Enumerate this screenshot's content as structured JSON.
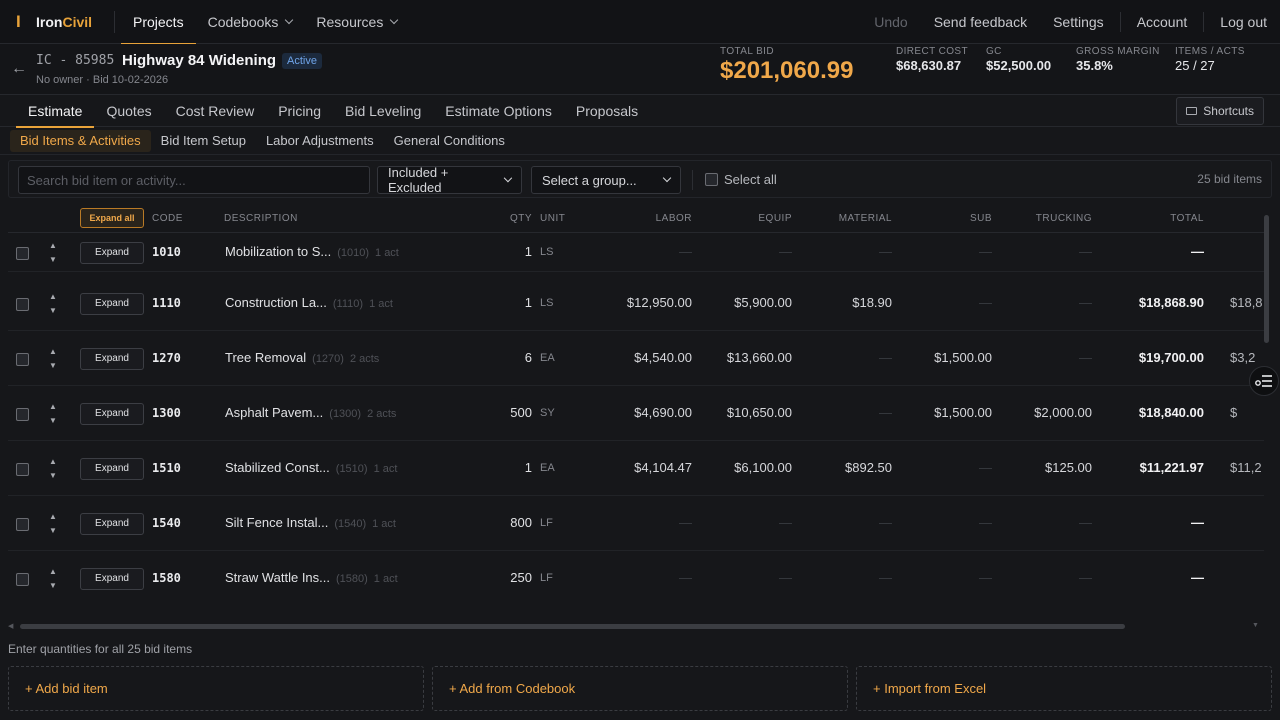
{
  "app": {
    "logo_prefix": "Iron",
    "logo_suffix": "Civil"
  },
  "nav": {
    "items": [
      {
        "label": "Projects",
        "active": true,
        "dropdown": false
      },
      {
        "label": "Codebooks",
        "active": false,
        "dropdown": true
      },
      {
        "label": "Resources",
        "active": false,
        "dropdown": true
      }
    ],
    "right": {
      "undo": "Undo",
      "feedback": "Send feedback",
      "settings": "Settings",
      "account": "Account",
      "logout": "Log out"
    }
  },
  "project": {
    "code": "IC - 85985",
    "name": "Highway 84 Widening",
    "status": "Active",
    "subtitle": "No owner · Bid 10-02-2026",
    "back_icon": "back-arrow-icon"
  },
  "stats": {
    "total_bid_label": "TOTAL BID",
    "total_bid": "$201,060.99",
    "direct_cost_label": "DIRECT COST",
    "direct_cost": "$68,630.87",
    "gc_label": "GC",
    "gc": "$52,500.00",
    "gross_margin_label": "GROSS MARGIN",
    "gross_margin": "35.8%",
    "items_acts_label": "ITEMS / ACTS",
    "items_acts": "25 / 27"
  },
  "tabs": [
    {
      "label": "Estimate",
      "active": true
    },
    {
      "label": "Quotes",
      "active": false
    },
    {
      "label": "Cost Review",
      "active": false
    },
    {
      "label": "Pricing",
      "active": false
    },
    {
      "label": "Bid Leveling",
      "active": false
    },
    {
      "label": "Estimate Options",
      "active": false
    },
    {
      "label": "Proposals",
      "active": false
    }
  ],
  "shortcuts_label": "Shortcuts",
  "subtabs": [
    {
      "label": "Bid Items & Activities",
      "active": true
    },
    {
      "label": "Bid Item Setup",
      "active": false
    },
    {
      "label": "Labor Adjustments",
      "active": false
    },
    {
      "label": "General Conditions",
      "active": false
    }
  ],
  "filter": {
    "search_placeholder": "Search bid item or activity...",
    "inclusion_select": "Included + Excluded",
    "group_select": "Select a group...",
    "select_all": "Select all",
    "count": "25 bid items"
  },
  "table": {
    "expand_all": "Expand all",
    "columns": {
      "code": "CODE",
      "description": "DESCRIPTION",
      "qty": "QTY",
      "unit": "UNIT",
      "labor": "LABOR",
      "equip": "EQUIP",
      "material": "MATERIAL",
      "sub": "SUB",
      "trucking": "TRUCKING",
      "total": "TOTAL"
    },
    "expand_label": "Expand",
    "empty": "—",
    "rows": [
      {
        "code": "1010",
        "description": "Mobilization to S...",
        "meta_code": "(1010)",
        "acts": "1 act",
        "qty": "1",
        "unit": "LS",
        "labor": "—",
        "equip": "—",
        "material": "—",
        "sub": "—",
        "trucking": "—",
        "total": "—",
        "overflow": ""
      },
      {
        "code": "1110",
        "description": "Construction La...",
        "meta_code": "(1110)",
        "acts": "1 act",
        "qty": "1",
        "unit": "LS",
        "labor": "$12,950.00",
        "equip": "$5,900.00",
        "material": "$18.90",
        "sub": "—",
        "trucking": "—",
        "total": "$18,868.90",
        "overflow": "$18,8"
      },
      {
        "code": "1270",
        "description": "Tree Removal",
        "meta_code": "(1270)",
        "acts": "2 acts",
        "qty": "6",
        "unit": "EA",
        "labor": "$4,540.00",
        "equip": "$13,660.00",
        "material": "—",
        "sub": "$1,500.00",
        "trucking": "—",
        "total": "$19,700.00",
        "overflow": "$3,2"
      },
      {
        "code": "1300",
        "description": "Asphalt Pavem...",
        "meta_code": "(1300)",
        "acts": "2 acts",
        "qty": "500",
        "unit": "SY",
        "labor": "$4,690.00",
        "equip": "$10,650.00",
        "material": "—",
        "sub": "$1,500.00",
        "trucking": "$2,000.00",
        "total": "$18,840.00",
        "overflow": "$"
      },
      {
        "code": "1510",
        "description": "Stabilized Const...",
        "meta_code": "(1510)",
        "acts": "1 act",
        "qty": "1",
        "unit": "EA",
        "labor": "$4,104.47",
        "equip": "$6,100.00",
        "material": "$892.50",
        "sub": "—",
        "trucking": "$125.00",
        "total": "$11,221.97",
        "overflow": "$11,2"
      },
      {
        "code": "1540",
        "description": "Silt Fence Instal...",
        "meta_code": "(1540)",
        "acts": "1 act",
        "qty": "800",
        "unit": "LF",
        "labor": "—",
        "equip": "—",
        "material": "—",
        "sub": "—",
        "trucking": "—",
        "total": "—",
        "overflow": ""
      },
      {
        "code": "1580",
        "description": "Straw Wattle Ins...",
        "meta_code": "(1580)",
        "acts": "1 act",
        "qty": "250",
        "unit": "LF",
        "labor": "—",
        "equip": "—",
        "material": "—",
        "sub": "—",
        "trucking": "—",
        "total": "—",
        "overflow": ""
      }
    ]
  },
  "footer": {
    "hint": "Enter quantities for all 25 bid items",
    "add_bid_item": "+ Add bid item",
    "add_from_codebook": "+ Add from Codebook",
    "import_excel": "+ Import from Excel"
  },
  "colors": {
    "accent": "#e8a33a",
    "total_bid": "#f0a84a",
    "status_active": "#6fa4e8",
    "background": "#16171a"
  }
}
